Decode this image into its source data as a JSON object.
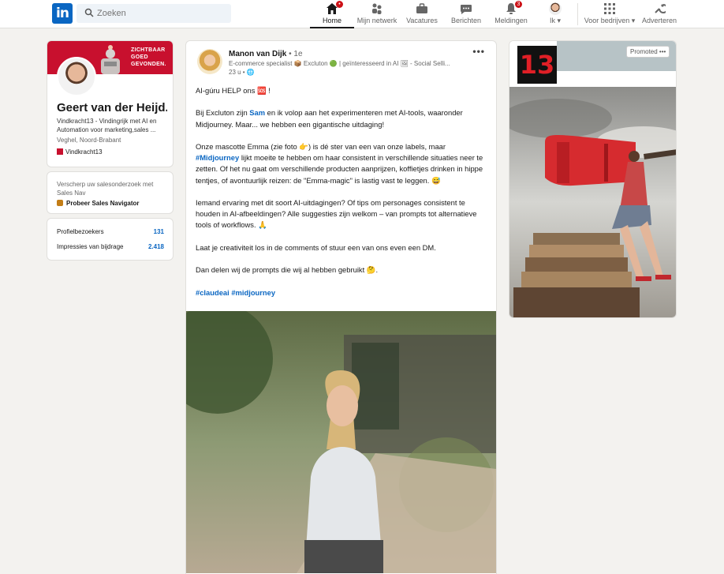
{
  "nav": {
    "search_placeholder": "Zoeken",
    "items": [
      {
        "label": "Home",
        "icon": "home-icon",
        "active": true
      },
      {
        "label": "Mijn netwerk",
        "icon": "network-icon"
      },
      {
        "label": "Vacatures",
        "icon": "briefcase-icon"
      },
      {
        "label": "Berichten",
        "icon": "messaging-icon"
      },
      {
        "label": "Meldingen",
        "icon": "bell-icon",
        "badge": "3"
      },
      {
        "label": "Ik",
        "icon": "avatar-icon"
      },
      {
        "label": "Voor bedrijven",
        "icon": "grid-icon"
      },
      {
        "label": "Adverteren",
        "icon": "advertise-icon"
      }
    ],
    "home_badge": "•"
  },
  "profile": {
    "banner_text": [
      "ZICHTBAAR",
      "GOED",
      "GEVONDEN."
    ],
    "name": "Geert van der Heijd...",
    "headline": "Vindkracht13 - Vindingrijk met AI en Automation voor marketing,sales ...",
    "location": "Veghel, Noord-Brabant",
    "company": "Vindkracht13"
  },
  "promo": {
    "text": "Verscherp uw salesonderzoek met Sales Nav",
    "link": "Probeer Sales Navigator"
  },
  "stats": [
    {
      "label": "Profielbezoekers",
      "value": "131"
    },
    {
      "label": "Impressies van bijdrage",
      "value": "2.418"
    }
  ],
  "post": {
    "author": "Manon van Dijk",
    "degree": "• 1e",
    "subtitle": "E-commerce specialist 📦 Excluton 🟢 | geïnteresseerd in AI 🖼 - Social Selli...",
    "time": "23 u •",
    "more": "•••",
    "p1": "AI-gúru HELP ons 🆘 !",
    "p2_a": "Bij Excluton zijn ",
    "p2_mention": "Sam",
    "p2_b": " en ik volop aan het experimenteren met AI-tools, waaronder Midjourney. Maar... we hebben een gigantische uitdaging!",
    "p3_a": "Onze mascotte Emma (zie foto 👉) is dé ster van een van onze labels, maar ",
    "p3_tag": "#Midjourney",
    "p3_b": " lijkt moeite te hebben om haar consistent in verschillende situaties neer te zetten. Of het nu gaat om verschillende producten aanprijzen, koffietjes drinken in hippe tentjes, of avontuurlijk reizen: de \"Emma-magic\" is lastig vast te leggen. 😅",
    "p4": "Iemand ervaring met dit soort AI-uitdagingen? Of tips om personages consistent te houden in AI-afbeeldingen? Alle suggesties zijn welkom – van prompts tot alternatieve tools of workflows. 🙏",
    "p5": "Laat je creativiteit los in de comments of stuur een van ons even een DM.",
    "p6": "Dan delen wij de prompts die wij al hebben gebruikt 🤔.",
    "tags": "#claudeai #midjourney"
  },
  "ad": {
    "logo": "13",
    "promoted": "Promoted •••"
  }
}
